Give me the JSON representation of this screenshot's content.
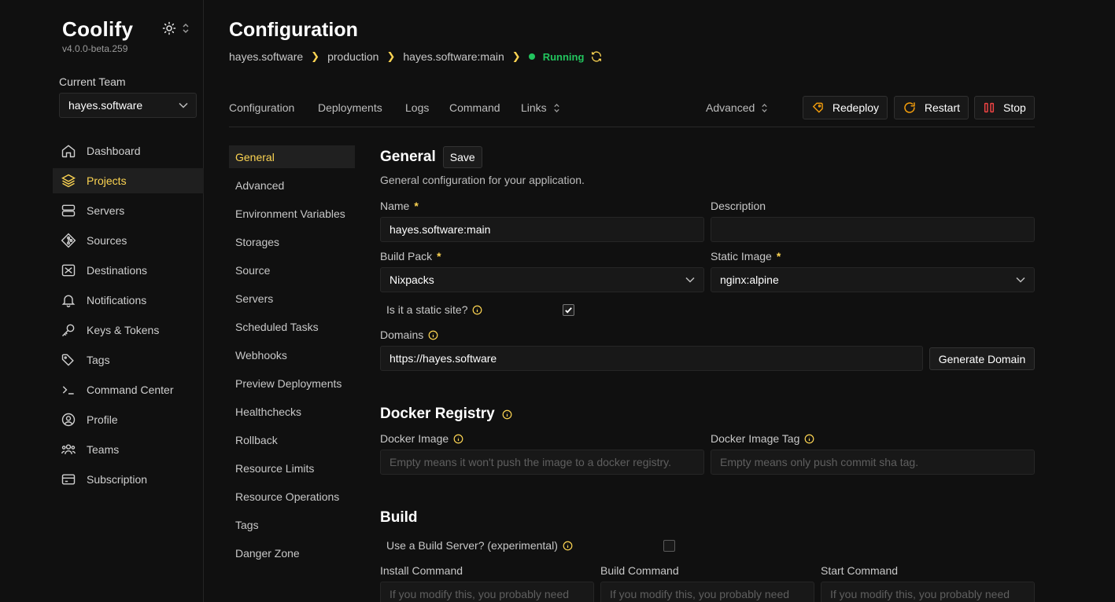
{
  "app": {
    "name": "Coolify",
    "version": "v4.0.0-beta.259"
  },
  "team": {
    "label": "Current Team",
    "selected": "hayes.software"
  },
  "nav": [
    {
      "label": "Dashboard",
      "icon": "home-icon"
    },
    {
      "label": "Projects",
      "icon": "layers-icon",
      "active": true
    },
    {
      "label": "Servers",
      "icon": "server-icon"
    },
    {
      "label": "Sources",
      "icon": "git-icon"
    },
    {
      "label": "Destinations",
      "icon": "destination-icon"
    },
    {
      "label": "Notifications",
      "icon": "bell-icon"
    },
    {
      "label": "Keys & Tokens",
      "icon": "key-icon"
    },
    {
      "label": "Tags",
      "icon": "tag-icon"
    },
    {
      "label": "Command Center",
      "icon": "terminal-icon"
    },
    {
      "label": "Profile",
      "icon": "user-circle-icon"
    },
    {
      "label": "Teams",
      "icon": "users-icon"
    },
    {
      "label": "Subscription",
      "icon": "credit-card-icon"
    }
  ],
  "page": {
    "title": "Configuration"
  },
  "breadcrumb": {
    "team": "hayes.software",
    "environment": "production",
    "resource": "hayes.software:main",
    "status": "Running"
  },
  "tabs": {
    "configuration": "Configuration",
    "deployments": "Deployments",
    "logs": "Logs",
    "command": "Command",
    "links": "Links",
    "advanced": "Advanced"
  },
  "actions": {
    "redeploy": "Redeploy",
    "restart": "Restart",
    "stop": "Stop"
  },
  "subnav": [
    {
      "label": "General",
      "active": true
    },
    {
      "label": "Advanced"
    },
    {
      "label": "Environment Variables"
    },
    {
      "label": "Storages"
    },
    {
      "label": "Source"
    },
    {
      "label": "Servers"
    },
    {
      "label": "Scheduled Tasks"
    },
    {
      "label": "Webhooks"
    },
    {
      "label": "Preview Deployments"
    },
    {
      "label": "Healthchecks"
    },
    {
      "label": "Rollback"
    },
    {
      "label": "Resource Limits"
    },
    {
      "label": "Resource Operations"
    },
    {
      "label": "Tags"
    },
    {
      "label": "Danger Zone"
    }
  ],
  "general": {
    "title": "General",
    "save_label": "Save",
    "description": "General configuration for your application.",
    "name_label": "Name",
    "name_value": "hayes.software:main",
    "description_label": "Description",
    "description_value": "",
    "build_pack_label": "Build Pack",
    "build_pack_value": "Nixpacks",
    "static_image_label": "Static Image",
    "static_image_value": "nginx:alpine",
    "static_site_label": "Is it a static site?",
    "static_site_checked": true,
    "domains_label": "Domains",
    "domains_value": "https://hayes.software",
    "generate_domain_label": "Generate Domain"
  },
  "docker_registry": {
    "title": "Docker Registry",
    "image_label": "Docker Image",
    "image_placeholder": "Empty means it won't push the image to a docker registry.",
    "tag_label": "Docker Image Tag",
    "tag_placeholder": "Empty means only push commit sha tag."
  },
  "build": {
    "title": "Build",
    "build_server_label": "Use a Build Server? (experimental)",
    "build_server_checked": false,
    "install_label": "Install Command",
    "build_label": "Build Command",
    "start_label": "Start Command",
    "command_placeholder": "If you modify this, you probably need"
  },
  "colors": {
    "accent": "#fcd452",
    "running": "#22c55e",
    "stop": "#ef4444",
    "background": "#101010"
  }
}
